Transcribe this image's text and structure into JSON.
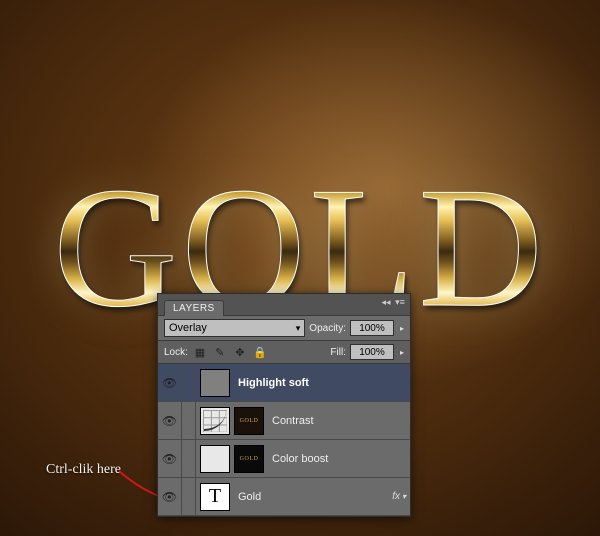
{
  "canvas": {
    "text": "GOLD"
  },
  "panel": {
    "tab_label": "LAYERS",
    "blend_mode": "Overlay",
    "opacity_label": "Opacity:",
    "opacity_value": "100%",
    "lock_label": "Lock:",
    "fill_label": "Fill:",
    "fill_value": "100%",
    "layers": [
      {
        "name": "Highlight soft",
        "selected": true,
        "type": "fill"
      },
      {
        "name": "Contrast",
        "selected": false,
        "type": "curves",
        "mini": "GOLD"
      },
      {
        "name": "Color boost",
        "selected": false,
        "type": "gradmap",
        "mini": "GOLD"
      },
      {
        "name": "Gold",
        "selected": false,
        "type": "text",
        "fx": "fx"
      }
    ]
  },
  "annotation": {
    "text": "Ctrl-clik here"
  }
}
